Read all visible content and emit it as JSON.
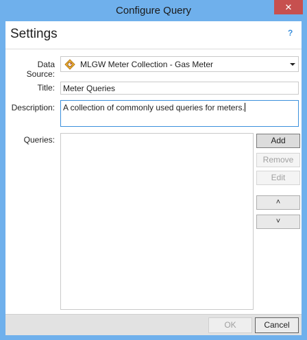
{
  "window": {
    "title": "Configure Query",
    "close_glyph": "✕"
  },
  "header": {
    "title": "Settings",
    "help_glyph": "?"
  },
  "form": {
    "data_source_label": "Data Source:",
    "data_source_value": "MLGW Meter Collection - Gas Meter",
    "data_source_icon": "gas-meter-icon",
    "title_label": "Title:",
    "title_value": "Meter Queries",
    "description_label": "Description:",
    "description_value": "A collection of commonly used queries for meters.",
    "queries_label": "Queries:"
  },
  "query_buttons": {
    "add": "Add",
    "remove": "Remove",
    "edit": "Edit",
    "up_glyph": "˄",
    "down_glyph": "˅"
  },
  "footer": {
    "ok": "OK",
    "cancel": "Cancel"
  },
  "colors": {
    "titlebar": "#6fb0ec",
    "close": "#c7504f",
    "accent": "#3a8fdc"
  }
}
